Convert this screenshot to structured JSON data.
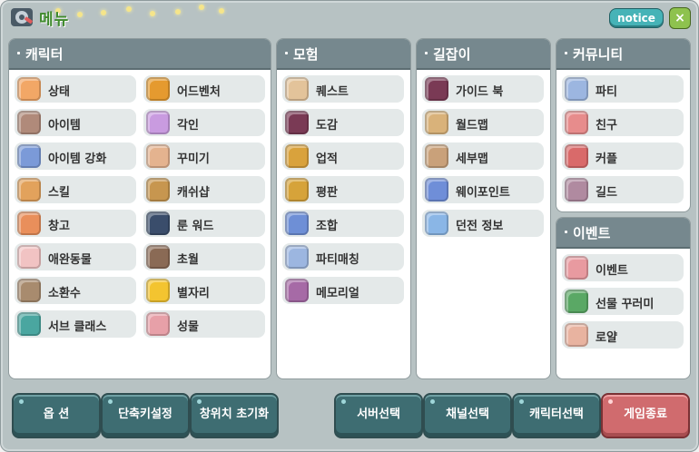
{
  "title": "메뉴",
  "notice_label": "notice",
  "close_label": "×",
  "colors": {
    "accent": "#76888e",
    "title_green": "#3f8a2c",
    "exit_red": "#d06b6e"
  },
  "sections": [
    {
      "title": "캐릭터",
      "items": [
        {
          "label": "상태",
          "icon": "status-icon",
          "color": "#f2a766"
        },
        {
          "label": "어드벤처",
          "icon": "adventure-icon",
          "color": "#e59a2f"
        },
        {
          "label": "아이템",
          "icon": "item-icon",
          "color": "#b08a7a"
        },
        {
          "label": "각인",
          "icon": "engrave-icon",
          "color": "#c99be0"
        },
        {
          "label": "아이템 강화",
          "icon": "upgrade-icon",
          "color": "#7b9ad8"
        },
        {
          "label": "꾸미기",
          "icon": "decorate-icon",
          "color": "#e4b38f"
        },
        {
          "label": "스킬",
          "icon": "skill-icon",
          "color": "#e2a25c"
        },
        {
          "label": "캐쉬샵",
          "icon": "cashshop-icon",
          "color": "#c7964f"
        },
        {
          "label": "창고",
          "icon": "storage-icon",
          "color": "#e98f5b"
        },
        {
          "label": "룬 워드",
          "icon": "rune-icon",
          "color": "#3a4d6b"
        },
        {
          "label": "애완동물",
          "icon": "pet-icon",
          "color": "#f1c3c3"
        },
        {
          "label": "초월",
          "icon": "transcend-icon",
          "color": "#8a6a55"
        },
        {
          "label": "소환수",
          "icon": "summon-icon",
          "color": "#a88b6e"
        },
        {
          "label": "별자리",
          "icon": "star-icon",
          "color": "#f3c430"
        },
        {
          "label": "서브 클래스",
          "icon": "subclass-icon",
          "color": "#4aa6a0"
        },
        {
          "label": "성물",
          "icon": "relic-icon",
          "color": "#e7a0a8"
        }
      ]
    },
    {
      "title": "모험",
      "items": [
        {
          "label": "퀘스트",
          "icon": "quest-icon",
          "color": "#e3c39a"
        },
        {
          "label": "도감",
          "icon": "codex-icon",
          "color": "#7a3a55"
        },
        {
          "label": "업적",
          "icon": "achievement-icon",
          "color": "#d9a23c"
        },
        {
          "label": "평판",
          "icon": "reputation-icon",
          "color": "#d6a33a"
        },
        {
          "label": "조합",
          "icon": "craft-icon",
          "color": "#6e8fd6"
        },
        {
          "label": "파티매칭",
          "icon": "party-matching-icon",
          "color": "#9cb6e0"
        },
        {
          "label": "메모리얼",
          "icon": "memorial-icon",
          "color": "#a66aa6"
        }
      ]
    },
    {
      "title": "길잡이",
      "items": [
        {
          "label": "가이드 북",
          "icon": "guidebook-icon",
          "color": "#7a3a55"
        },
        {
          "label": "월드맵",
          "icon": "worldmap-icon",
          "color": "#d9b27a"
        },
        {
          "label": "세부맵",
          "icon": "detailmap-icon",
          "color": "#c9a17a"
        },
        {
          "label": "웨이포인트",
          "icon": "waypoint-icon",
          "color": "#6f8ed8"
        },
        {
          "label": "던전 정보",
          "icon": "dungeon-icon",
          "color": "#8ab6e6"
        }
      ]
    },
    {
      "title": "커뮤니티",
      "items": [
        {
          "label": "파티",
          "icon": "party-icon",
          "color": "#9cb6e0"
        },
        {
          "label": "친구",
          "icon": "friend-icon",
          "color": "#e78c8c"
        },
        {
          "label": "커플",
          "icon": "couple-icon",
          "color": "#d96a6a"
        },
        {
          "label": "길드",
          "icon": "guild-icon",
          "color": "#b08aa0"
        }
      ]
    },
    {
      "title": "이벤트",
      "items": [
        {
          "label": "이벤트",
          "icon": "event-icon",
          "color": "#e89aa0"
        },
        {
          "label": "선물 꾸러미",
          "icon": "gift-icon",
          "color": "#5aa865"
        },
        {
          "label": "로얄",
          "icon": "royal-icon",
          "color": "#e8b3a0"
        }
      ]
    }
  ],
  "footer_buttons": [
    {
      "label": "옵 션",
      "style": "teal"
    },
    {
      "label": "단축키설정",
      "style": "teal"
    },
    {
      "label": "창위치 초기화",
      "style": "teal"
    },
    {
      "label": "서버선택",
      "style": "teal"
    },
    {
      "label": "채널선택",
      "style": "teal"
    },
    {
      "label": "캐릭터선택",
      "style": "teal"
    },
    {
      "label": "게임종료",
      "style": "red"
    }
  ]
}
